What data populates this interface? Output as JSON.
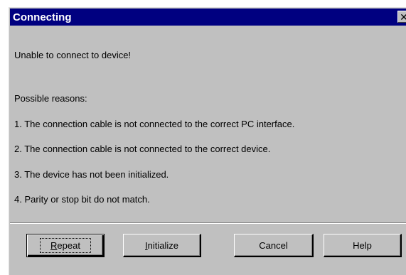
{
  "dialog": {
    "title": "Connecting",
    "close_glyph": "✕"
  },
  "message": {
    "headline": "Unable to connect to device!",
    "reasons_label": "Possible reasons:",
    "reasons": [
      "1. The connection cable is not connected to the correct PC interface.",
      "2. The connection cable is not connected to the correct device.",
      "3. The device has not been initialized.",
      "4. Parity or stop bit do not match."
    ]
  },
  "buttons": {
    "repeat": {
      "mnemonic": "R",
      "rest": "epeat"
    },
    "initialize": {
      "mnemonic": "I",
      "rest": "nitialize"
    },
    "cancel": "Cancel",
    "help": "Help"
  },
  "colors": {
    "titlebar": "#000080",
    "dialog_face": "#c0c0c0",
    "title_text": "#ffffff"
  }
}
